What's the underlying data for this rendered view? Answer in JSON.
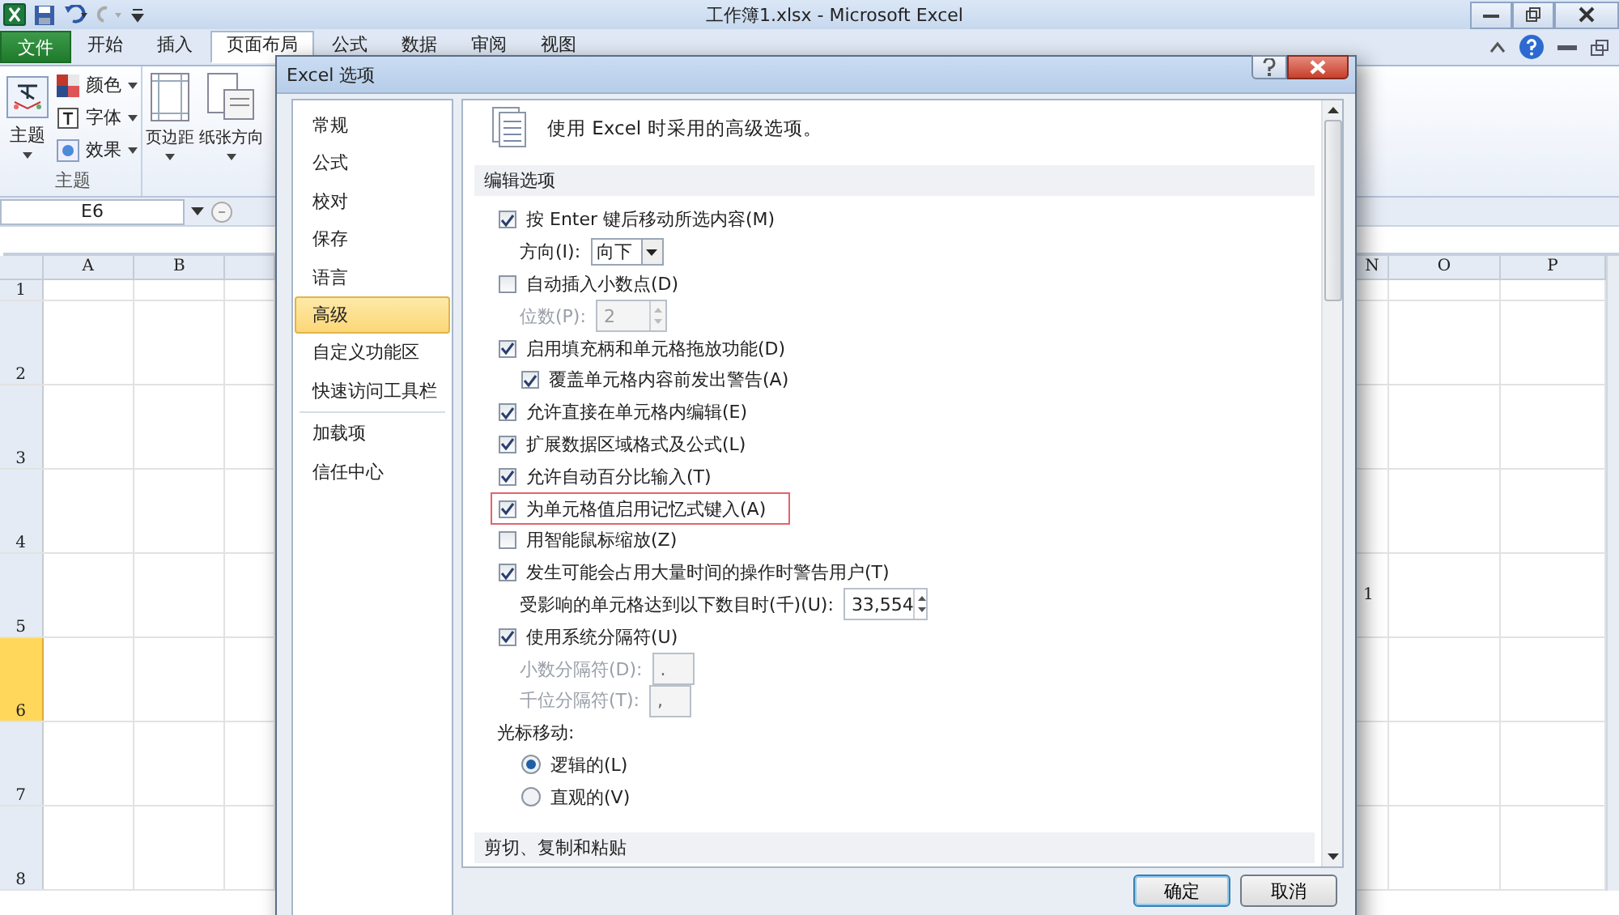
{
  "window": {
    "title": "工作簿1.xlsx - Microsoft Excel"
  },
  "ribbon_tabs": [
    {
      "label": "文件",
      "kind": "file",
      "selected": false
    },
    {
      "label": "开始",
      "kind": "tab",
      "selected": false
    },
    {
      "label": "插入",
      "kind": "tab",
      "selected": false
    },
    {
      "label": "页面布局",
      "kind": "tab",
      "selected": true
    },
    {
      "label": "公式",
      "kind": "tab",
      "selected": false
    },
    {
      "label": "数据",
      "kind": "tab",
      "selected": false
    },
    {
      "label": "审阅",
      "kind": "tab",
      "selected": false
    },
    {
      "label": "视图",
      "kind": "tab",
      "selected": false
    }
  ],
  "ribbon": {
    "theme_button": "主题",
    "theme_items": [
      "颜色",
      "字体",
      "效果"
    ],
    "group_label": "主题",
    "page_buttons": [
      "页边距",
      "纸张方向"
    ]
  },
  "sheet": {
    "name_box": "E6",
    "left_columns": [
      {
        "label": "A",
        "selected": false
      },
      {
        "label": "B",
        "selected": false
      }
    ],
    "right_columns": [
      {
        "label": "N",
        "selected": false
      },
      {
        "label": "O",
        "selected": false
      },
      {
        "label": "P",
        "selected": false
      }
    ],
    "rows": [
      {
        "label": "1",
        "selected": false
      },
      {
        "label": "2",
        "selected": false
      },
      {
        "label": "3",
        "selected": false
      },
      {
        "label": "4",
        "selected": false
      },
      {
        "label": "5",
        "selected": false,
        "cell_n": "1"
      },
      {
        "label": "6",
        "selected": true
      },
      {
        "label": "7",
        "selected": false
      },
      {
        "label": "8",
        "selected": false
      }
    ]
  },
  "dialog": {
    "title": "Excel 选项",
    "nav": [
      {
        "label": "常规",
        "selected": false
      },
      {
        "label": "公式",
        "selected": false
      },
      {
        "label": "校对",
        "selected": false
      },
      {
        "label": "保存",
        "selected": false
      },
      {
        "label": "语言",
        "selected": false
      },
      {
        "label": "高级",
        "selected": true
      },
      {
        "label": "自定义功能区",
        "selected": false
      },
      {
        "label": "快速访问工具栏",
        "selected": false,
        "separator_after": true
      },
      {
        "label": "加载项",
        "selected": false
      },
      {
        "label": "信任中心",
        "selected": false
      }
    ],
    "heading": "使用 Excel 时采用的高级选项。",
    "sections": [
      {
        "title": "编辑选项",
        "items": [
          {
            "kind": "checkbox",
            "label": "按 Enter 键后移动所选内容(M)",
            "checked": true,
            "highlighted": false,
            "children": [
              {
                "kind": "dropdown",
                "label": "方向(I):",
                "value": "向下",
                "disabled": false
              }
            ]
          },
          {
            "kind": "checkbox",
            "label": "自动插入小数点(D)",
            "checked": false,
            "highlighted": false,
            "children": [
              {
                "kind": "spinner",
                "label": "位数(P):",
                "value": "2",
                "disabled": true
              }
            ]
          },
          {
            "kind": "checkbox",
            "label": "启用填充柄和单元格拖放功能(D)",
            "checked": true,
            "highlighted": false,
            "children": [
              {
                "kind": "checkbox",
                "label": "覆盖单元格内容前发出警告(A)",
                "checked": true,
                "highlighted": false
              }
            ]
          },
          {
            "kind": "checkbox",
            "label": "允许直接在单元格内编辑(E)",
            "checked": true,
            "highlighted": false
          },
          {
            "kind": "checkbox",
            "label": "扩展数据区域格式及公式(L)",
            "checked": true,
            "highlighted": false
          },
          {
            "kind": "checkbox",
            "label": "允许自动百分比输入(T)",
            "checked": true,
            "highlighted": false
          },
          {
            "kind": "checkbox",
            "label": "为单元格值启用记忆式键入(A)",
            "checked": true,
            "highlighted": true
          },
          {
            "kind": "checkbox",
            "label": "用智能鼠标缩放(Z)",
            "checked": false,
            "highlighted": false
          },
          {
            "kind": "checkbox",
            "label": "发生可能会占用大量时间的操作时警告用户(T)",
            "checked": true,
            "highlighted": false,
            "children": [
              {
                "kind": "spinner",
                "label": "受影响的单元格达到以下数目时(千)(U):",
                "value": "33,554",
                "disabled": false
              }
            ]
          },
          {
            "kind": "checkbox",
            "label": "使用系统分隔符(U)",
            "checked": true,
            "highlighted": false,
            "children": [
              {
                "kind": "field",
                "label": "小数分隔符(D):",
                "value": ".",
                "disabled": true
              },
              {
                "kind": "field",
                "label": "千位分隔符(T):",
                "value": ",",
                "disabled": true
              }
            ]
          },
          {
            "kind": "label",
            "label": "光标移动:",
            "children": [
              {
                "kind": "radio",
                "label": "逻辑的(L)",
                "selected": true
              },
              {
                "kind": "radio",
                "label": "直观的(V)",
                "selected": false
              }
            ]
          }
        ]
      },
      {
        "title": "剪切、复制和粘贴"
      }
    ],
    "buttons": [
      {
        "label": "确定",
        "kind": "default"
      },
      {
        "label": "取消",
        "kind": "normal"
      }
    ]
  }
}
